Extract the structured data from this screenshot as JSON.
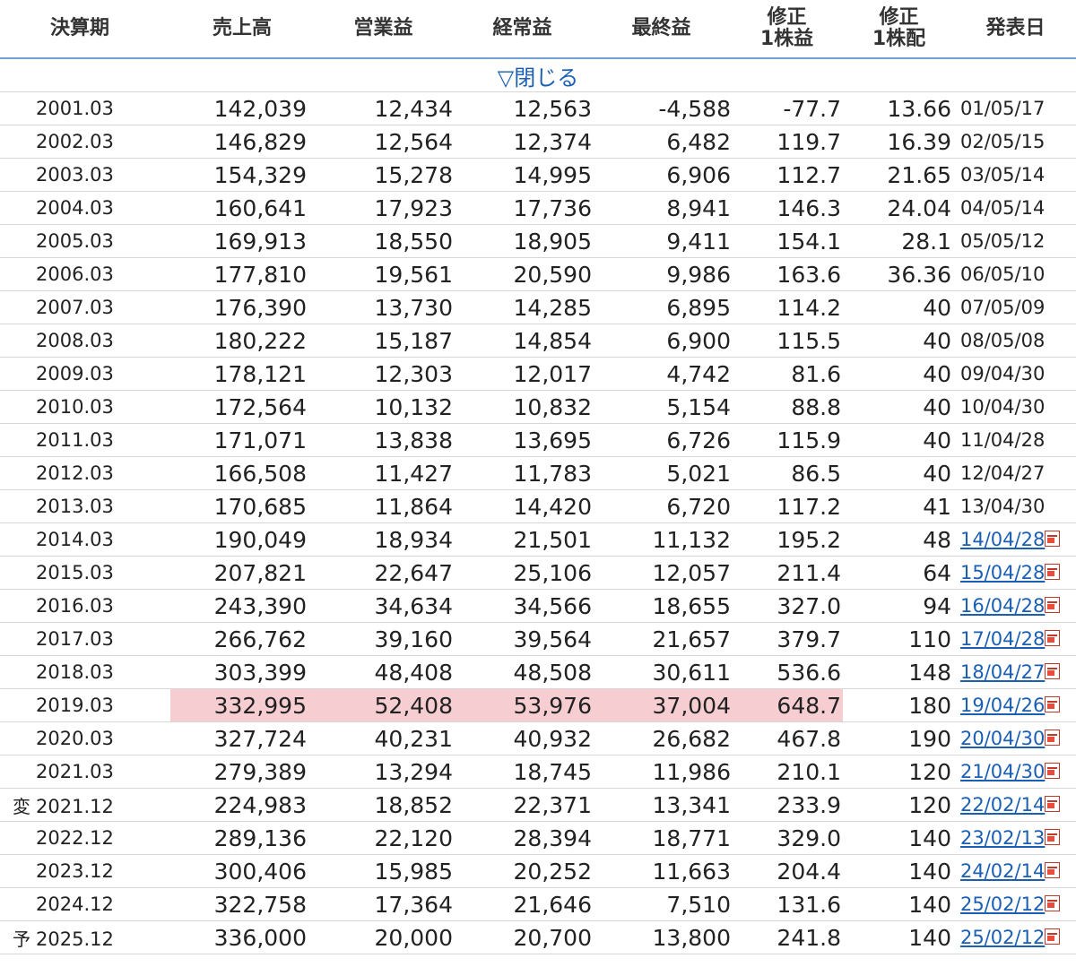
{
  "headers": [
    "決算期",
    "売上高",
    "営業益",
    "経常益",
    "最終益",
    "修正\n1株益",
    "修正\n1株配",
    "発表日"
  ],
  "close_label": "▽閉じる",
  "rows": [
    {
      "mark": "",
      "period": "2001.03",
      "sales": "142,039",
      "op": "12,434",
      "ord": "12,563",
      "net": "-4,588",
      "eps": "-77.7",
      "div": "13.66",
      "date": "01/05/17",
      "link": false
    },
    {
      "mark": "",
      "period": "2002.03",
      "sales": "146,829",
      "op": "12,564",
      "ord": "12,374",
      "net": "6,482",
      "eps": "119.7",
      "div": "16.39",
      "date": "02/05/15",
      "link": false
    },
    {
      "mark": "",
      "period": "2003.03",
      "sales": "154,329",
      "op": "15,278",
      "ord": "14,995",
      "net": "6,906",
      "eps": "112.7",
      "div": "21.65",
      "date": "03/05/14",
      "link": false
    },
    {
      "mark": "",
      "period": "2004.03",
      "sales": "160,641",
      "op": "17,923",
      "ord": "17,736",
      "net": "8,941",
      "eps": "146.3",
      "div": "24.04",
      "date": "04/05/14",
      "link": false
    },
    {
      "mark": "",
      "period": "2005.03",
      "sales": "169,913",
      "op": "18,550",
      "ord": "18,905",
      "net": "9,411",
      "eps": "154.1",
      "div": "28.1",
      "date": "05/05/12",
      "link": false
    },
    {
      "mark": "",
      "period": "2006.03",
      "sales": "177,810",
      "op": "19,561",
      "ord": "20,590",
      "net": "9,986",
      "eps": "163.6",
      "div": "36.36",
      "date": "06/05/10",
      "link": false
    },
    {
      "mark": "",
      "period": "2007.03",
      "sales": "176,390",
      "op": "13,730",
      "ord": "14,285",
      "net": "6,895",
      "eps": "114.2",
      "div": "40",
      "date": "07/05/09",
      "link": false
    },
    {
      "mark": "",
      "period": "2008.03",
      "sales": "180,222",
      "op": "15,187",
      "ord": "14,854",
      "net": "6,900",
      "eps": "115.5",
      "div": "40",
      "date": "08/05/08",
      "link": false
    },
    {
      "mark": "",
      "period": "2009.03",
      "sales": "178,121",
      "op": "12,303",
      "ord": "12,017",
      "net": "4,742",
      "eps": "81.6",
      "div": "40",
      "date": "09/04/30",
      "link": false
    },
    {
      "mark": "",
      "period": "2010.03",
      "sales": "172,564",
      "op": "10,132",
      "ord": "10,832",
      "net": "5,154",
      "eps": "88.8",
      "div": "40",
      "date": "10/04/30",
      "link": false
    },
    {
      "mark": "",
      "period": "2011.03",
      "sales": "171,071",
      "op": "13,838",
      "ord": "13,695",
      "net": "6,726",
      "eps": "115.9",
      "div": "40",
      "date": "11/04/28",
      "link": false
    },
    {
      "mark": "",
      "period": "2012.03",
      "sales": "166,508",
      "op": "11,427",
      "ord": "11,783",
      "net": "5,021",
      "eps": "86.5",
      "div": "40",
      "date": "12/04/27",
      "link": false
    },
    {
      "mark": "",
      "period": "2013.03",
      "sales": "170,685",
      "op": "11,864",
      "ord": "14,420",
      "net": "6,720",
      "eps": "117.2",
      "div": "41",
      "date": "13/04/30",
      "link": false
    },
    {
      "mark": "",
      "period": "2014.03",
      "sales": "190,049",
      "op": "18,934",
      "ord": "21,501",
      "net": "11,132",
      "eps": "195.2",
      "div": "48",
      "date": "14/04/28",
      "link": true
    },
    {
      "mark": "",
      "period": "2015.03",
      "sales": "207,821",
      "op": "22,647",
      "ord": "25,106",
      "net": "12,057",
      "eps": "211.4",
      "div": "64",
      "date": "15/04/28",
      "link": true
    },
    {
      "mark": "",
      "period": "2016.03",
      "sales": "243,390",
      "op": "34,634",
      "ord": "34,566",
      "net": "18,655",
      "eps": "327.0",
      "div": "94",
      "date": "16/04/28",
      "link": true
    },
    {
      "mark": "",
      "period": "2017.03",
      "sales": "266,762",
      "op": "39,160",
      "ord": "39,564",
      "net": "21,657",
      "eps": "379.7",
      "div": "110",
      "date": "17/04/28",
      "link": true
    },
    {
      "mark": "",
      "period": "2018.03",
      "sales": "303,399",
      "op": "48,408",
      "ord": "48,508",
      "net": "30,611",
      "eps": "536.6",
      "div": "148",
      "date": "18/04/27",
      "link": true
    },
    {
      "mark": "",
      "period": "2019.03",
      "sales": "332,995",
      "op": "52,408",
      "ord": "53,976",
      "net": "37,004",
      "eps": "648.7",
      "div": "180",
      "date": "19/04/26",
      "link": true,
      "highlight": true
    },
    {
      "mark": "",
      "period": "2020.03",
      "sales": "327,724",
      "op": "40,231",
      "ord": "40,932",
      "net": "26,682",
      "eps": "467.8",
      "div": "190",
      "date": "20/04/30",
      "link": true
    },
    {
      "mark": "",
      "period": "2021.03",
      "sales": "279,389",
      "op": "13,294",
      "ord": "18,745",
      "net": "11,986",
      "eps": "210.1",
      "div": "120",
      "date": "21/04/30",
      "link": true
    },
    {
      "mark": "変",
      "period": "2021.12",
      "sales": "224,983",
      "op": "18,852",
      "ord": "22,371",
      "net": "13,341",
      "eps": "233.9",
      "div": "120",
      "date": "22/02/14",
      "link": true
    },
    {
      "mark": "",
      "period": "2022.12",
      "sales": "289,136",
      "op": "22,120",
      "ord": "28,394",
      "net": "18,771",
      "eps": "329.0",
      "div": "140",
      "date": "23/02/13",
      "link": true
    },
    {
      "mark": "",
      "period": "2023.12",
      "sales": "300,406",
      "op": "15,985",
      "ord": "20,252",
      "net": "11,663",
      "eps": "204.4",
      "div": "140",
      "date": "24/02/14",
      "link": true
    },
    {
      "mark": "",
      "period": "2024.12",
      "sales": "322,758",
      "op": "17,364",
      "ord": "21,646",
      "net": "7,510",
      "eps": "131.6",
      "div": "140",
      "date": "25/02/12",
      "link": true
    },
    {
      "mark": "予",
      "period": "2025.12",
      "sales": "336,000",
      "op": "20,000",
      "ord": "20,700",
      "net": "13,800",
      "eps": "241.8",
      "div": "140",
      "date": "25/02/12",
      "link": true
    }
  ],
  "colors": {
    "header_rule": "#6fa0d6",
    "link": "#1a5fb4",
    "highlight": "#f6cdd0",
    "pdf_icon": "#c0392b"
  }
}
